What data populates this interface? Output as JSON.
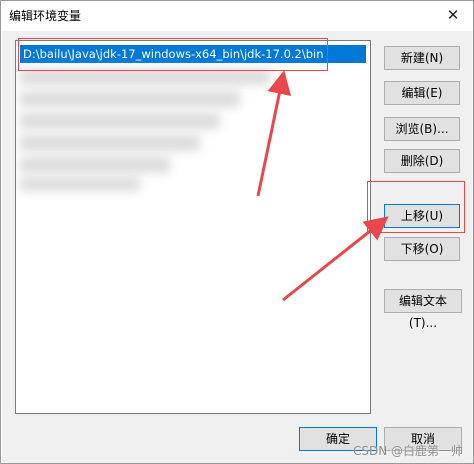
{
  "window": {
    "title": "编辑环境变量",
    "close_glyph": "✕"
  },
  "list": {
    "selected_path": "D:\\bailu\\Java\\jdk-17_windows-x64_bin\\jdk-17.0.2\\bin"
  },
  "buttons": {
    "new": "新建(N)",
    "edit": "编辑(E)",
    "browse": "浏览(B)...",
    "delete": "删除(D)",
    "move_up": "上移(U)",
    "move_down": "下移(O)",
    "edit_text": "编辑文本(T)...",
    "ok": "确定",
    "cancel": "取消"
  },
  "watermark": "CSDN @白鹿第一帅",
  "colors": {
    "selection": "#0078d7",
    "annotation": "#e8474c"
  }
}
